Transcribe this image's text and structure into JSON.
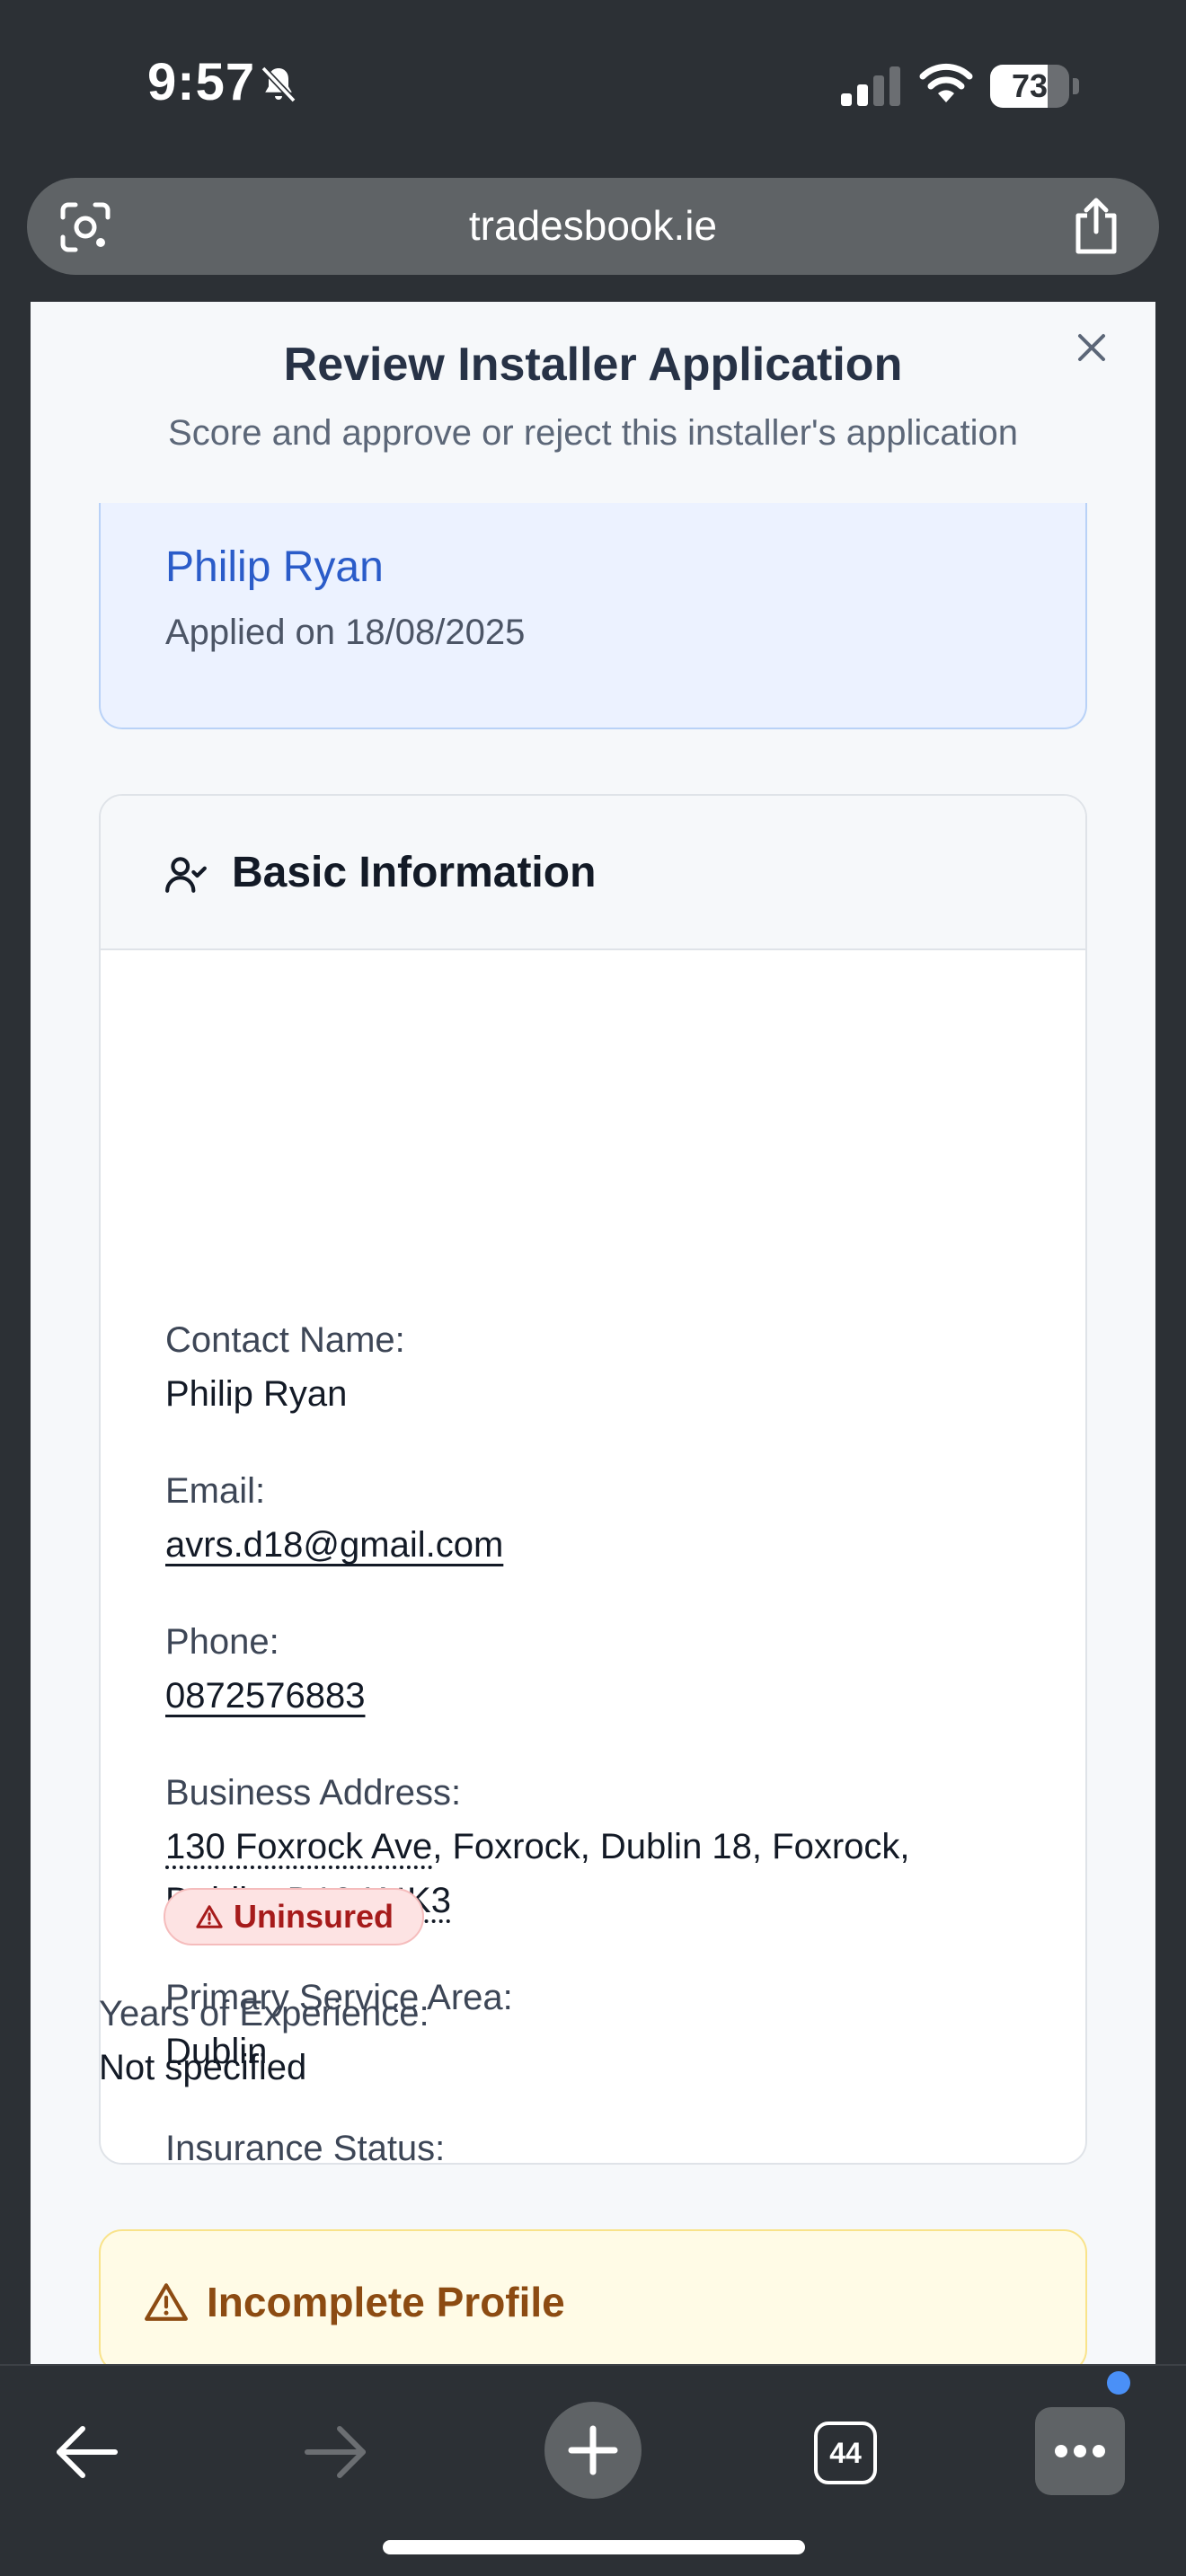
{
  "status_bar": {
    "time": "9:57",
    "battery_percent": "73",
    "battery_level": 0.73,
    "icons": [
      "bell-slash-icon",
      "signal-icon",
      "wifi-icon",
      "battery-icon"
    ]
  },
  "browser": {
    "url": "tradesbook.ie",
    "tab_count": "44",
    "icons": [
      "lens-icon",
      "share-icon",
      "back-icon",
      "forward-icon",
      "plus-icon",
      "more-icon"
    ]
  },
  "modal": {
    "title": "Review Installer Application",
    "subtitle": "Score and approve or reject this installer's application",
    "applicant": {
      "name": "Philip Ryan",
      "applied": "Applied on 18/08/2025"
    },
    "basic_info": {
      "title": "Basic Information",
      "contact_name_label": "Contact Name:",
      "contact_name": "Philip Ryan",
      "email_label": "Email:",
      "email": "avrs.d18@gmail.com",
      "phone_label": "Phone:",
      "phone": "0872576883",
      "address_label": "Business Address:",
      "address_street": "130 Foxrock Ave",
      "address_rest": ", Foxrock, Dublin 18, Foxrock,",
      "address_city": "Dublin, ",
      "address_postcode": "D18 K4K3",
      "service_area_label": "Primary Service Area:",
      "service_area": "Dublin",
      "insurance_label": "Insurance Status:",
      "insurance_status": "Uninsured",
      "experience_label": "Years of Experience:",
      "experience": "Not specified"
    },
    "warning": {
      "title": "Incomplete Profile"
    }
  },
  "colors": {
    "accent_blue": "#2b5cc9",
    "danger": "#a61b1b",
    "warning": "#8c4b12"
  }
}
